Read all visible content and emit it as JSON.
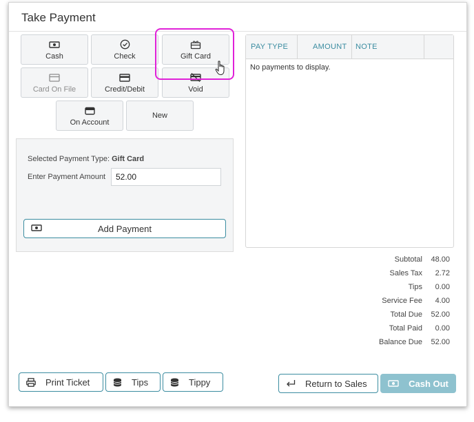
{
  "window": {
    "title": "Take Payment"
  },
  "payment_types": [
    {
      "label": "Cash",
      "icon": "cash-icon"
    },
    {
      "label": "Check",
      "icon": "check-circle-icon"
    },
    {
      "label": "Gift Card",
      "icon": "gift-card-icon"
    },
    {
      "label": "Card On File",
      "icon": "card-icon",
      "disabled": true
    },
    {
      "label": "Credit/Debit",
      "icon": "credit-card-icon"
    },
    {
      "label": "Void",
      "icon": "void-card-icon"
    },
    {
      "label": "On Account",
      "icon": "wallet-icon"
    },
    {
      "label": "New"
    }
  ],
  "form": {
    "selected_label": "Selected Payment Type: ",
    "selected_value": "Gift Card",
    "amount_label": "Enter Payment Amount",
    "amount_value": "52.00",
    "add_button": "Add Payment"
  },
  "payments_table": {
    "headers": [
      "PAY TYPE",
      "AMOUNT",
      "NOTE"
    ],
    "empty_message": "No payments to display."
  },
  "totals": [
    {
      "label": "Subtotal",
      "value": "48.00"
    },
    {
      "label": "Sales Tax",
      "value": "2.72"
    },
    {
      "label": "Tips",
      "value": "0.00"
    },
    {
      "label": "Service Fee",
      "value": "4.00"
    },
    {
      "label": "Total Due",
      "value": "52.00"
    },
    {
      "label": "Total Paid",
      "value": "0.00"
    },
    {
      "label": "Balance Due",
      "value": "52.00"
    }
  ],
  "footer": {
    "print_ticket": "Print Ticket",
    "tips": "Tips",
    "tippy": "Tippy",
    "return_to_sales": "Return to Sales",
    "cash_out": "Cash Out"
  },
  "colors": {
    "accent": "#3a8ca0",
    "highlight": "#e020d8",
    "cash_out_bg": "#8ec2cf"
  }
}
